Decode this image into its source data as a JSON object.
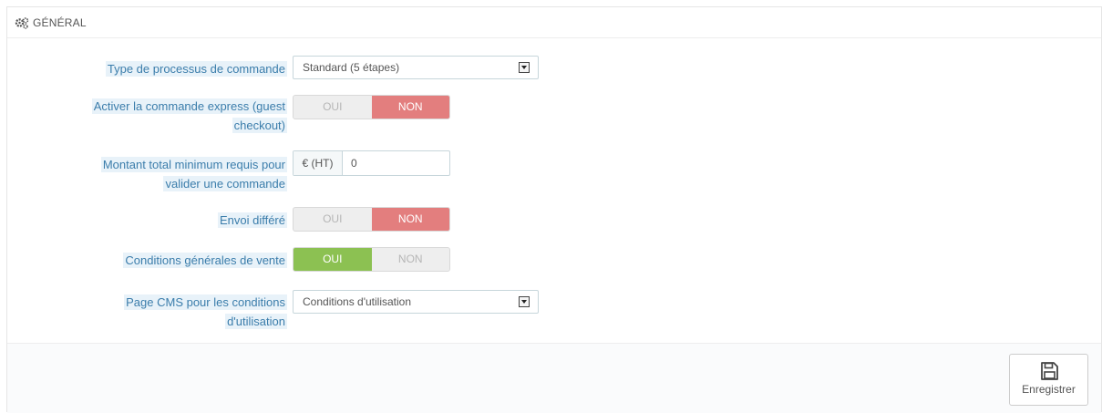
{
  "panel": {
    "title": "GÉNÉRAL",
    "icon": "gears-icon"
  },
  "fields": {
    "order_process": {
      "label": "Type de processus de commande",
      "value": "Standard (5 étapes)"
    },
    "guest_checkout": {
      "label_line1": "Activer la commande express (guest",
      "label_line2": "checkout)",
      "yes": "OUI",
      "no": "NON",
      "selected": "NON"
    },
    "min_amount": {
      "label_line1": "Montant total minimum requis pour",
      "label_line2": "valider une commande",
      "addon": "€ (HT)",
      "value": "0"
    },
    "delayed_shipping": {
      "label": "Envoi différé",
      "yes": "OUI",
      "no": "NON",
      "selected": "NON"
    },
    "terms": {
      "label": "Conditions générales de vente",
      "yes": "OUI",
      "no": "NON",
      "selected": "OUI"
    },
    "cms_page": {
      "label_line1": "Page CMS pour les conditions",
      "label_line2": "d'utilisation",
      "value": "Conditions d'utilisation"
    }
  },
  "footer": {
    "save_label": "Enregistrer",
    "save_icon": "floppy-disk-icon"
  },
  "colors": {
    "label": "#3b7dab",
    "label_bg": "#e8f2f9",
    "no_active": "#e37e7e",
    "yes_active": "#8cc152"
  }
}
